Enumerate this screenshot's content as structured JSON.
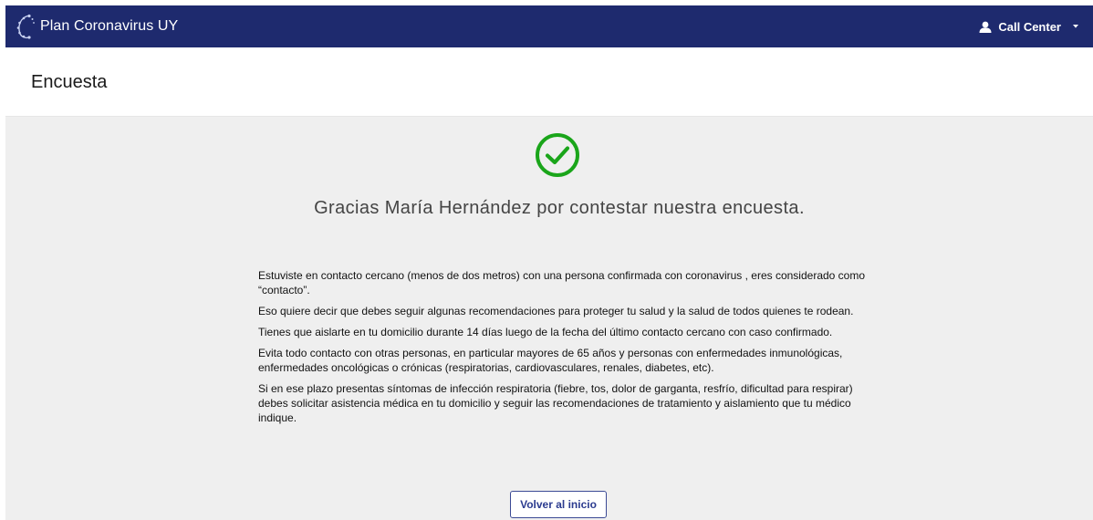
{
  "header": {
    "app_title": "Plan Coronavirus UY",
    "user_label": "Call Center",
    "user_icon": "user-icon",
    "dropdown_icon": "caret-down-icon",
    "logo_icon": "virus-logo-icon"
  },
  "page": {
    "title": "Encuesta"
  },
  "confirmation": {
    "icon": "check-circle-icon",
    "icon_color": "#1aa51a",
    "thanks": "Gracias María Hernández por contestar nuestra encuesta.",
    "paragraphs": [
      "Estuviste en contacto cercano (menos de dos metros) con una persona confirmada con coronavirus , eres considerado como “contacto”.",
      "Eso quiere decir que debes seguir algunas recomendaciones para proteger tu salud y la salud de todos quienes te rodean.",
      "Tienes que aislarte en tu domicilio durante 14 días luego de la fecha del último contacto cercano con caso confirmado.",
      "Evita todo contacto con otras personas, en particular mayores de 65 años y personas con enfermedades inmunológicas, enfermedades oncológicas o crónicas (respiratorias, cardiovasculares, renales, diabetes, etc).",
      "Si en ese plazo presentas síntomas de infección respiratoria (fiebre, tos, dolor de garganta, resfrío, dificultad para respirar) debes solicitar asistencia médica en tu domicilio y seguir las recomendaciones de tratamiento y aislamiento que tu médico indique."
    ],
    "back_button": "Volver al inicio"
  },
  "colors": {
    "topbar": "#1e2a6e",
    "content_bg": "#efefef",
    "button_border": "#3b4a95"
  }
}
